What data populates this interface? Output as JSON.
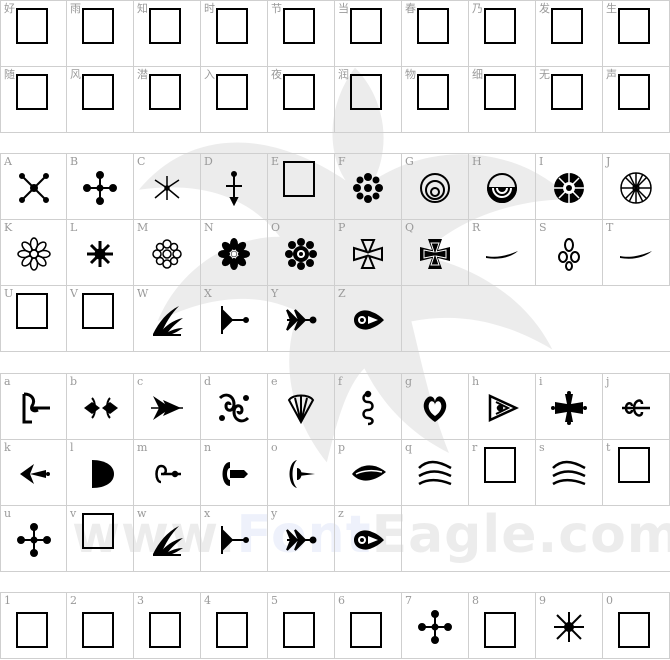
{
  "watermark": {
    "pre": "www.",
    "accent": "Font",
    "post": "Eagle.com"
  },
  "sections": [
    {
      "id": "cjk",
      "rows": [
        [
          {
            "label": "好",
            "glyph": "tofu"
          },
          {
            "label": "雨",
            "glyph": "tofu"
          },
          {
            "label": "知",
            "glyph": "tofu"
          },
          {
            "label": "时",
            "glyph": "tofu"
          },
          {
            "label": "节",
            "glyph": "tofu"
          },
          {
            "label": "当",
            "glyph": "tofu"
          },
          {
            "label": "春",
            "glyph": "tofu"
          },
          {
            "label": "乃",
            "glyph": "tofu"
          },
          {
            "label": "发",
            "glyph": "tofu"
          },
          {
            "label": "生",
            "glyph": "tofu"
          }
        ],
        [
          {
            "label": "随",
            "glyph": "tofu"
          },
          {
            "label": "风",
            "glyph": "tofu"
          },
          {
            "label": "潜",
            "glyph": "tofu"
          },
          {
            "label": "入",
            "glyph": "tofu"
          },
          {
            "label": "夜",
            "glyph": "tofu"
          },
          {
            "label": "润",
            "glyph": "tofu"
          },
          {
            "label": "物",
            "glyph": "tofu"
          },
          {
            "label": "细",
            "glyph": "tofu"
          },
          {
            "label": "无",
            "glyph": "tofu"
          },
          {
            "label": "声",
            "glyph": "tofu"
          }
        ]
      ]
    },
    {
      "id": "upper",
      "rows": [
        [
          {
            "label": "A",
            "glyph": "x-cross"
          },
          {
            "label": "B",
            "glyph": "plus-cross"
          },
          {
            "label": "C",
            "glyph": "twig"
          },
          {
            "label": "D",
            "glyph": "dagger"
          },
          {
            "label": "E",
            "glyph": "tofu"
          },
          {
            "label": "F",
            "glyph": "flower-dots"
          },
          {
            "label": "G",
            "glyph": "concentric"
          },
          {
            "label": "H",
            "glyph": "half-sun"
          },
          {
            "label": "I",
            "glyph": "wheel-solid"
          },
          {
            "label": "J",
            "glyph": "wheel-spokes"
          }
        ],
        [
          {
            "label": "K",
            "glyph": "rosette"
          },
          {
            "label": "L",
            "glyph": "snowflake"
          },
          {
            "label": "M",
            "glyph": "daisy"
          },
          {
            "label": "N",
            "glyph": "flower-bold"
          },
          {
            "label": "O",
            "glyph": "sunflower"
          },
          {
            "label": "P",
            "glyph": "maltese-outline"
          },
          {
            "label": "Q",
            "glyph": "iron-cross"
          },
          {
            "label": "R",
            "glyph": "swoosh"
          },
          {
            "label": "S",
            "glyph": "trefoil"
          },
          {
            "label": "T",
            "glyph": "swoosh"
          }
        ],
        [
          {
            "label": "U",
            "glyph": "tofu"
          },
          {
            "label": "V",
            "glyph": "tofu"
          },
          {
            "label": "W",
            "glyph": "leaf-spray"
          },
          {
            "label": "X",
            "glyph": "arrow-tail"
          },
          {
            "label": "Y",
            "glyph": "arrow-feather"
          },
          {
            "label": "Z",
            "glyph": "scroll"
          }
        ]
      ]
    },
    {
      "id": "lower",
      "rows": [
        [
          {
            "label": "a",
            "glyph": "bracket-scroll"
          },
          {
            "label": "b",
            "glyph": "border-orn"
          },
          {
            "label": "c",
            "glyph": "arrow-fancy"
          },
          {
            "label": "d",
            "glyph": "baroque"
          },
          {
            "label": "e",
            "glyph": "shell"
          },
          {
            "label": "f",
            "glyph": "scroll-vert"
          },
          {
            "label": "g",
            "glyph": "heart-orn"
          },
          {
            "label": "h",
            "glyph": "triangle-orn"
          },
          {
            "label": "i",
            "glyph": "cross-pattee"
          },
          {
            "label": "j",
            "glyph": "scroll-branch"
          }
        ],
        [
          {
            "label": "k",
            "glyph": "fleuron-left"
          },
          {
            "label": "l",
            "glyph": "half-disc"
          },
          {
            "label": "m",
            "glyph": "curl-arrow"
          },
          {
            "label": "n",
            "glyph": "curl-key"
          },
          {
            "label": "o",
            "glyph": "curl-heart"
          },
          {
            "label": "p",
            "glyph": "leaf-long"
          },
          {
            "label": "q",
            "glyph": "waves"
          },
          {
            "label": "r",
            "glyph": "tofu"
          },
          {
            "label": "s",
            "glyph": "waves"
          },
          {
            "label": "t",
            "glyph": "tofu"
          }
        ],
        [
          {
            "label": "u",
            "glyph": "plus-cross"
          },
          {
            "label": "v",
            "glyph": "tofu"
          },
          {
            "label": "w",
            "glyph": "leaf-spray"
          },
          {
            "label": "x",
            "glyph": "arrow-tail"
          },
          {
            "label": "y",
            "glyph": "arrow-feather"
          },
          {
            "label": "z",
            "glyph": "scroll"
          }
        ]
      ]
    },
    {
      "id": "digits",
      "rows": [
        [
          {
            "label": "1",
            "glyph": "tofu-low"
          },
          {
            "label": "2",
            "glyph": "tofu-low"
          },
          {
            "label": "3",
            "glyph": "tofu-low"
          },
          {
            "label": "4",
            "glyph": "tofu-low"
          },
          {
            "label": "5",
            "glyph": "tofu-low"
          },
          {
            "label": "6",
            "glyph": "tofu-low"
          },
          {
            "label": "7",
            "glyph": "plus-cross"
          },
          {
            "label": "8",
            "glyph": "tofu-low"
          },
          {
            "label": "9",
            "glyph": "x-star"
          },
          {
            "label": "0",
            "glyph": "tofu-low"
          }
        ]
      ]
    }
  ]
}
